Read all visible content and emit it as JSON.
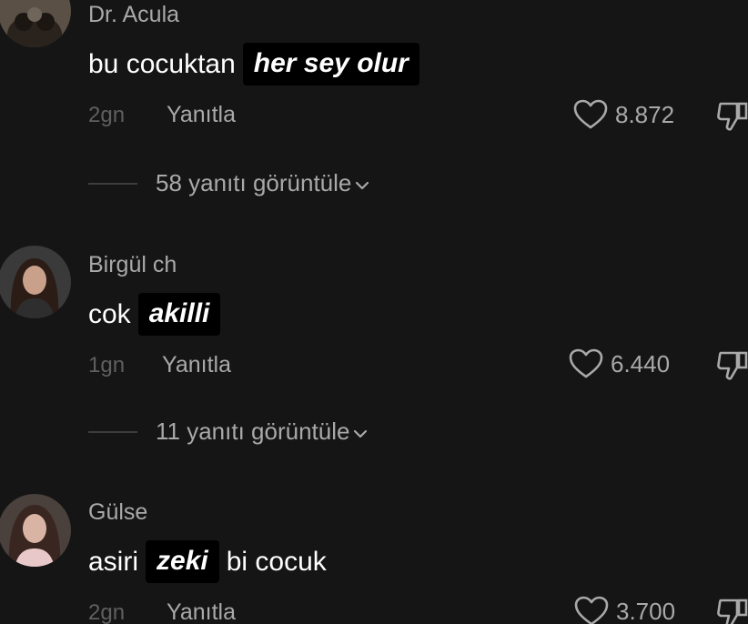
{
  "comments": [
    {
      "username": "Dr. Acula",
      "text_before": "bu cocuktan",
      "highlight": "her sey olur",
      "text_after": "",
      "time": "2gn",
      "reply_label": "Yanıtla",
      "likes": "8.872",
      "replies_label": "58 yanıtı görüntüle"
    },
    {
      "username": "Birgül ch",
      "text_before": "cok",
      "highlight": "akilli",
      "text_after": "",
      "time": "1gn",
      "reply_label": "Yanıtla",
      "likes": "6.440",
      "replies_label": "11 yanıtı görüntüle"
    },
    {
      "username": "Gülse",
      "text_before": "asiri",
      "highlight": "zeki",
      "text_after": "bi cocuk",
      "time": "2gn",
      "reply_label": "Yanıtla",
      "likes": "3.700"
    }
  ],
  "colors": {
    "background": "#151515",
    "username": "#a9a9a9",
    "timestamp": "#5f5f5f",
    "highlight_bg": "#000000"
  },
  "icons": [
    "heart-icon",
    "thumbs-down-icon",
    "chevron-down-icon"
  ]
}
